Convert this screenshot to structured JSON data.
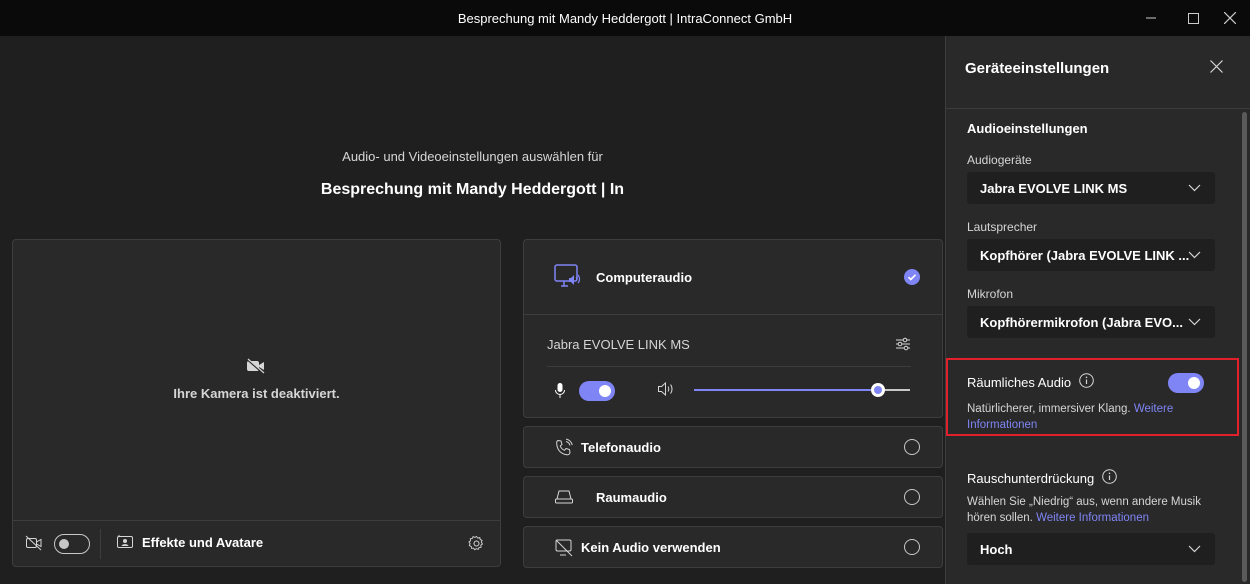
{
  "window": {
    "title": "Besprechung mit Mandy Heddergott | IntraConnect GmbH"
  },
  "main": {
    "subtitle": "Audio- und Videoeinstellungen auswählen für",
    "meeting_title": "Besprechung mit Mandy Heddergott | In",
    "camera": {
      "off_text": "Ihre Kamera ist deaktiviert.",
      "effects_label": "Effekte und Avatare",
      "camera_on": false
    },
    "audio_options": {
      "computer": {
        "label": "Computeraudio",
        "selected": true,
        "device": "Jabra EVOLVE LINK MS",
        "mic_on": true,
        "volume": 0.85
      },
      "phone": {
        "label": "Telefonaudio"
      },
      "room": {
        "label": "Raumaudio"
      },
      "none": {
        "label": "Kein Audio verwenden"
      }
    }
  },
  "panel": {
    "title": "Geräteeinstellungen",
    "audio_section": "Audioeinstellungen",
    "audio_devices_label": "Audiogeräte",
    "audio_devices_value": "Jabra EVOLVE LINK MS",
    "speaker_label": "Lautsprecher",
    "speaker_value": "Kopfhörer (Jabra EVOLVE LINK ...",
    "mic_label": "Mikrofon",
    "mic_value": "Kopfhörermikrofon (Jabra EVO...",
    "spatial": {
      "label": "Räumliches Audio",
      "on": true,
      "desc": "Natürlicherer, immersiver Klang.",
      "link": "Weitere Informationen"
    },
    "noise": {
      "label": "Rauschunterdrückung",
      "desc": "Wählen Sie „Niedrig“ aus, wenn andere Musik hören sollen.",
      "link": "Weitere Informationen",
      "value": "Hoch"
    }
  },
  "colors": {
    "accent": "#7f85f5",
    "highlight": "#e1202b",
    "background": "#1f1f1f",
    "panel": "#292929"
  },
  "icons": [
    "camera-off-icon",
    "settings-gear-icon",
    "effects-icon",
    "computer-audio-icon",
    "checkmark-icon",
    "sliders-icon",
    "microphone-icon",
    "speaker-icon",
    "phone-icon",
    "room-audio-icon",
    "no-audio-icon",
    "close-icon",
    "info-icon",
    "chevron-down-icon",
    "minimize-icon",
    "maximize-icon"
  ]
}
